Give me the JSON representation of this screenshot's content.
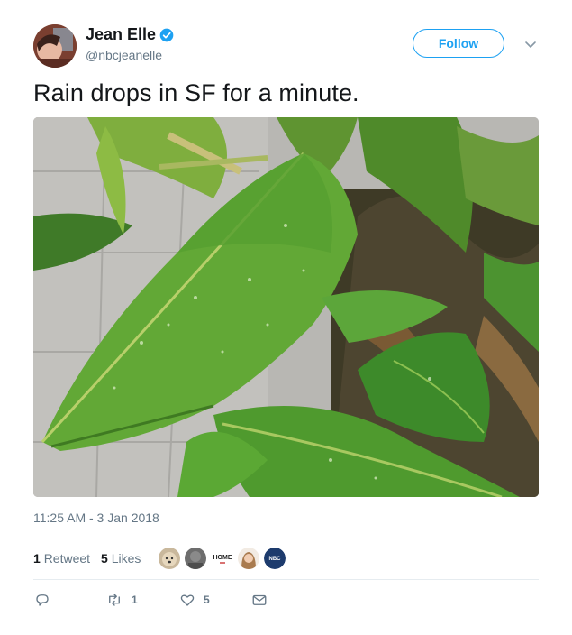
{
  "user": {
    "display_name": "Jean Elle",
    "handle": "@nbcjeanelle",
    "verified": true
  },
  "follow_button": {
    "label": "Follow"
  },
  "tweet": {
    "text": "Rain drops in SF for a minute.",
    "image_alt": "banana leaves with rain drops",
    "timestamp": "11:25 AM - 3 Jan 2018"
  },
  "stats": {
    "retweets_count": "1",
    "retweets_label": "Retweet",
    "likes_count": "5",
    "likes_label": "Likes",
    "likers": [
      {
        "name": "liker-1"
      },
      {
        "name": "liker-2"
      },
      {
        "name": "liker-3",
        "text": "HOME"
      },
      {
        "name": "liker-4"
      },
      {
        "name": "liker-5",
        "text": "NBC"
      }
    ]
  },
  "actions": {
    "reply_count": "",
    "retweet_count": "1",
    "like_count": "5"
  },
  "colors": {
    "accent": "#1da1f2",
    "text": "#14171a",
    "muted": "#657786",
    "divider": "#e6ecf0"
  }
}
